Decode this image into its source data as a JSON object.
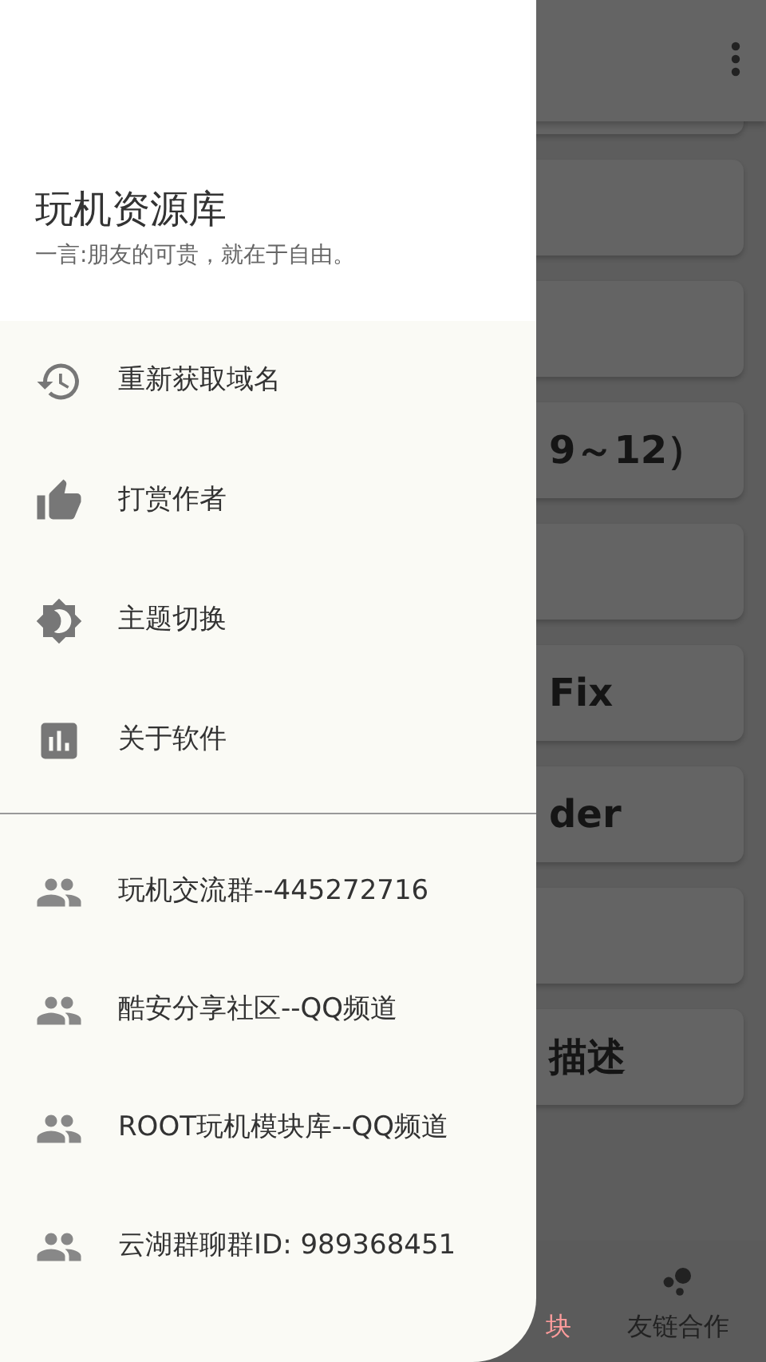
{
  "drawer": {
    "title": "玩机资源库",
    "subtitle": "一言:朋友的可贵，就在于自由。",
    "menu_items": [
      {
        "kind": "history",
        "label": "重新获取域名"
      },
      {
        "kind": "thumb",
        "label": "打赏作者"
      },
      {
        "kind": "theme",
        "label": "主题切换"
      },
      {
        "kind": "chart",
        "label": "关于软件"
      }
    ],
    "group_items": [
      {
        "label": "玩机交流群--445272716"
      },
      {
        "label": "酷安分享社区--QQ频道"
      },
      {
        "label": "ROOT玩机模块库--QQ频道"
      },
      {
        "label": "云湖群聊群ID: 989368451"
      }
    ]
  },
  "background": {
    "cards": [
      {
        "kind": "blank"
      },
      {
        "kind": "blank"
      },
      {
        "kind": "blank"
      },
      {
        "kind": "text",
        "text": "9～12）"
      },
      {
        "kind": "blank"
      },
      {
        "kind": "text",
        "text": "Fix"
      },
      {
        "kind": "text",
        "text": "der"
      },
      {
        "kind": "blank"
      },
      {
        "kind": "text",
        "text": "描述"
      }
    ],
    "bottom_nav": [
      {
        "label": "块",
        "selected": true
      },
      {
        "label": "友链合作",
        "selected": false
      }
    ]
  }
}
